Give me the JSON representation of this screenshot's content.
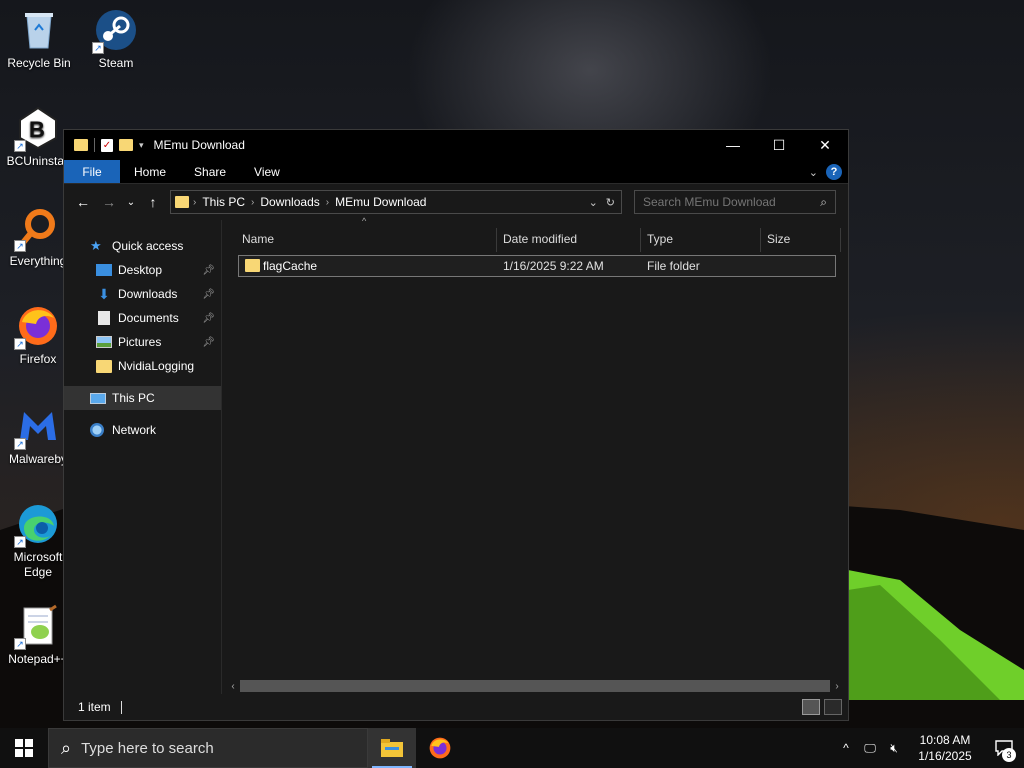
{
  "desktop": {
    "icons": [
      {
        "label": "Recycle Bin"
      },
      {
        "label": "Steam"
      },
      {
        "label": "BCUninstall"
      },
      {
        "label": "Everything"
      },
      {
        "label": "Firefox"
      },
      {
        "label": "Malwareby"
      },
      {
        "label": "Microsoft Edge"
      },
      {
        "label": "Notepad++"
      }
    ]
  },
  "window": {
    "title": "MEmu Download",
    "controls": {
      "minimize": "—",
      "maximize": "☐",
      "close": "✕"
    },
    "ribbon_tabs": [
      "File",
      "Home",
      "Share",
      "View"
    ],
    "help": "?",
    "address": {
      "crumbs": [
        "This PC",
        "Downloads",
        "MEmu Download"
      ]
    },
    "search": {
      "placeholder": "Search MEmu Download"
    },
    "nav": {
      "quick_access": "Quick access",
      "items": [
        {
          "label": "Desktop"
        },
        {
          "label": "Downloads"
        },
        {
          "label": "Documents"
        },
        {
          "label": "Pictures"
        },
        {
          "label": "NvidiaLogging"
        }
      ],
      "this_pc": "This PC",
      "network": "Network"
    },
    "columns": {
      "name": "Name",
      "date": "Date modified",
      "type": "Type",
      "size": "Size"
    },
    "files": [
      {
        "name": "flagCache",
        "date": "1/16/2025 9:22 AM",
        "type": "File folder",
        "size": ""
      }
    ],
    "status": "1 item"
  },
  "taskbar": {
    "search_placeholder": "Type here to search",
    "time": "10:08 AM",
    "date": "1/16/2025",
    "notifications": "3"
  },
  "colors": {
    "folder": "#f8d775",
    "accent": "#1a64b8",
    "window_bg": "#191919"
  }
}
